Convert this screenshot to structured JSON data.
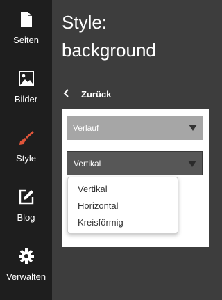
{
  "sidebar": {
    "items": [
      {
        "label": "Seiten",
        "icon": "page-icon"
      },
      {
        "label": "Bilder",
        "icon": "image-icon"
      },
      {
        "label": "Style",
        "icon": "brush-icon",
        "active_color": "#e0553a"
      },
      {
        "label": "Blog",
        "icon": "edit-icon"
      },
      {
        "label": "Verwalten",
        "icon": "gear-icon"
      }
    ]
  },
  "main": {
    "title_line1": "Style:",
    "title_line2": "background",
    "back_label": "Zurück",
    "select1_value": "Verlauf",
    "select2_value": "Vertikal",
    "dropdown_options": [
      "Vertikal",
      "Horizontal",
      "Kreisförmig"
    ]
  },
  "colors": {
    "sidebar_bg": "#1e1e1e",
    "main_bg": "#3d3d3d",
    "accent": "#e0553a"
  }
}
